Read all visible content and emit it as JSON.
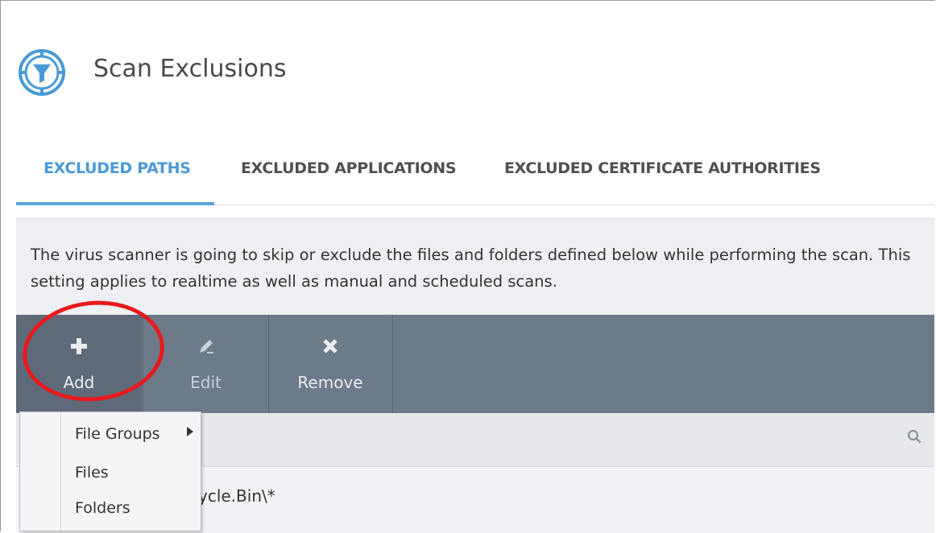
{
  "header": {
    "title": "Scan Exclusions",
    "icon": "shield-filter-icon"
  },
  "tabs": [
    {
      "label": "EXCLUDED PATHS",
      "active": true
    },
    {
      "label": "EXCLUDED APPLICATIONS",
      "active": false
    },
    {
      "label": "EXCLUDED CERTIFICATE AUTHORITIES",
      "active": false
    }
  ],
  "description": "The virus scanner is going to skip or exclude the files and folders defined below while performing the scan. This setting applies to realtime as well as manual and scheduled scans.",
  "toolbar": {
    "add": {
      "label": "Add",
      "icon": "plus-icon"
    },
    "edit": {
      "label": "Edit",
      "icon": "pencil-icon"
    },
    "remove": {
      "label": "Remove",
      "icon": "x-icon"
    }
  },
  "add_menu": [
    {
      "label": "File Groups",
      "has_submenu": true
    },
    {
      "label": "Files",
      "has_submenu": false
    },
    {
      "label": "Folders",
      "has_submenu": false
    }
  ],
  "list": {
    "search_icon": "search-icon",
    "rows": [
      "ycle.Bin\\*"
    ]
  },
  "colors": {
    "accent": "#5aa6dc",
    "toolbar": "#6d7a8a",
    "highlight": "#e8191c"
  }
}
